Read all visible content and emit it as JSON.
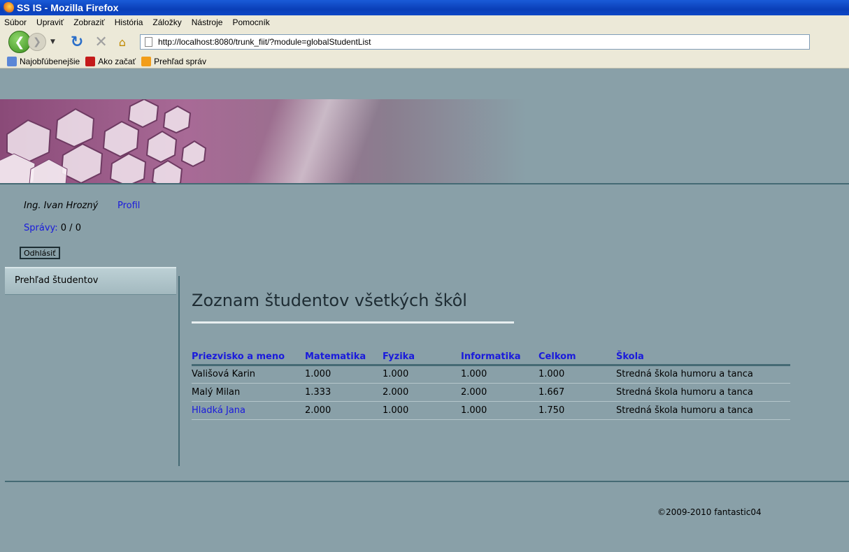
{
  "window": {
    "title": "SS IS - Mozilla Firefox"
  },
  "menu": [
    "Súbor",
    "Upraviť",
    "Zobraziť",
    "História",
    "Záložky",
    "Nástroje",
    "Pomocník"
  ],
  "address": {
    "url": "http://localhost:8080/trunk_fiit/?module=globalStudentList"
  },
  "bookmarks": [
    {
      "label": "Najobľúbenejšie",
      "icon": "bookmark-star-icon"
    },
    {
      "label": "Ako začať",
      "icon": "firefox-help-icon"
    },
    {
      "label": "Prehľad správ",
      "icon": "rss-feed-icon"
    }
  ],
  "user": {
    "name": "Ing. Ivan Hrozný",
    "profile_link": "Profil",
    "messages_label": "Správy:",
    "messages_count": "0 / 0",
    "logout_label": "Odhlásiť"
  },
  "sidebar": {
    "items": [
      {
        "label": "Prehľad študentov"
      }
    ]
  },
  "main": {
    "title": "Zoznam študentov všetkých škôl",
    "table": {
      "headers": [
        "Priezvisko a meno",
        "Matematika",
        "Fyzika",
        "Informatika",
        "Celkom",
        "Škola"
      ],
      "rows": [
        [
          "Vališová Karin",
          "1.000",
          "1.000",
          "1.000",
          "1.000",
          "Stredná škola humoru a tanca"
        ],
        [
          "Malý Milan",
          "1.333",
          "2.000",
          "2.000",
          "1.667",
          "Stredná škola humoru a tanca"
        ],
        [
          "Hladká Jana",
          "2.000",
          "1.000",
          "1.000",
          "1.750",
          "Stredná škola humoru a tanca"
        ]
      ]
    }
  },
  "footer": {
    "copyright": "©2009-2010 fantastic04"
  },
  "colors": {
    "page_bg": "#89a0a8",
    "link": "#1a1adc",
    "accent_line": "#456a74"
  }
}
